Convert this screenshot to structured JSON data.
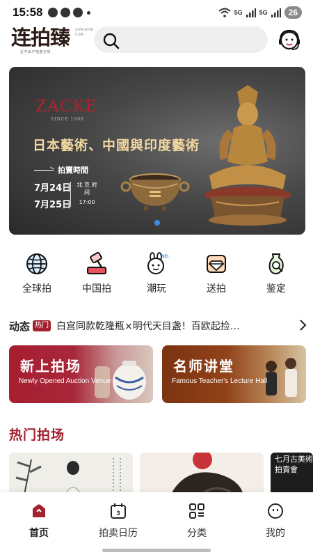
{
  "status_bar": {
    "time": "15:58",
    "network_1": "5G",
    "network_2": "5G",
    "battery": "26"
  },
  "header": {
    "logo": {
      "name": "连拍臻",
      "side_text": "SIYA DUVE COM",
      "slogan": "足不出户拍遍全球"
    },
    "search_icon": "search-icon",
    "service_icon": "customer-service-icon"
  },
  "banner": {
    "brand": "ZACKE",
    "since": "SINCE 1968",
    "title": "日本藝術、中國與印度藝術",
    "time_label": "拍賣時間",
    "date_1": "7月24日",
    "date_2": "7月25日",
    "location": "北 京 时 间",
    "hour": "17:00",
    "page_indicator_color": "#3b8ee0"
  },
  "categories": [
    {
      "label": "全球拍",
      "icon": "globe-icon"
    },
    {
      "label": "中国拍",
      "icon": "hammer-icon"
    },
    {
      "label": "潮玩",
      "icon": "rabbit-toy-icon"
    },
    {
      "label": "送拍",
      "icon": "gem-box-icon"
    },
    {
      "label": "鉴定",
      "icon": "vase-magnifier-icon"
    }
  ],
  "ticker": {
    "label": "动态",
    "badge": "热门",
    "text": "白宫同款乾隆瓶×明代天目盏！百欧起捡…"
  },
  "feature_cards": {
    "new_venue": {
      "title": "新上拍场",
      "subtitle": "Newly Opened Auction Venue"
    },
    "lecture": {
      "title": "名师讲堂",
      "subtitle": "Famous Teacher's Lecture Hall"
    }
  },
  "hot": {
    "title": "热门拍场",
    "card_3_text": "七月古美術拍賣會"
  },
  "bottom_nav": [
    {
      "label": "首页",
      "icon": "home-icon",
      "active": true
    },
    {
      "label": "拍卖日历",
      "icon": "calendar-icon",
      "active": false
    },
    {
      "label": "分类",
      "icon": "category-icon",
      "active": false
    },
    {
      "label": "我的",
      "icon": "profile-icon",
      "active": false
    }
  ],
  "colors": {
    "brand_red": "#a3212f",
    "banner_gold": "#f3d8a0"
  }
}
